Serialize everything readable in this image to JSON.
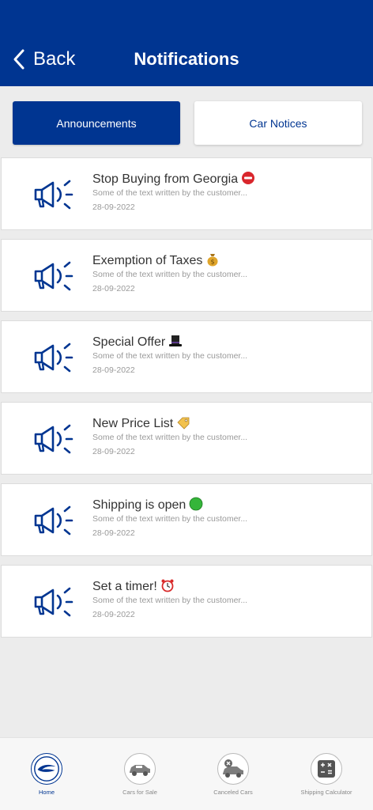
{
  "header": {
    "back_label": "Back",
    "title": "Notifications"
  },
  "tabs": [
    {
      "label": "Announcements",
      "active": true
    },
    {
      "label": "Car Notices",
      "active": false
    }
  ],
  "notifications": [
    {
      "title": "Stop Buying from Georgia",
      "emoji": "no-entry",
      "text": "Some of the text written by the customer...",
      "date": "28-09-2022"
    },
    {
      "title": "Exemption of Taxes",
      "emoji": "money-bag",
      "text": "Some of the text written by the customer...",
      "date": "28-09-2022"
    },
    {
      "title": "Special Offer",
      "emoji": "top-hat",
      "text": "Some of the text written by the customer...",
      "date": "28-09-2022"
    },
    {
      "title": "New Price List",
      "emoji": "price-tag",
      "text": "Some of the text written by the customer...",
      "date": "28-09-2022"
    },
    {
      "title": "Shipping is open",
      "emoji": "green-circle",
      "text": "Some of the text written by the customer...",
      "date": "28-09-2022"
    },
    {
      "title": "Set a timer!",
      "emoji": "alarm-clock",
      "text": "Some of the text written by the customer...",
      "date": "28-09-2022"
    }
  ],
  "bottom_nav": [
    {
      "label": "Home",
      "icon": "home-logo-icon",
      "active": true
    },
    {
      "label": "Cars for Sale",
      "icon": "car-for-sale-icon",
      "active": false
    },
    {
      "label": "Canceled Cars",
      "icon": "canceled-car-icon",
      "active": false
    },
    {
      "label": "Shipping Calculator",
      "icon": "calculator-icon",
      "active": false
    }
  ],
  "colors": {
    "brand_blue": "#003591",
    "background": "#ececec",
    "muted_text": "#9a9a9a"
  }
}
